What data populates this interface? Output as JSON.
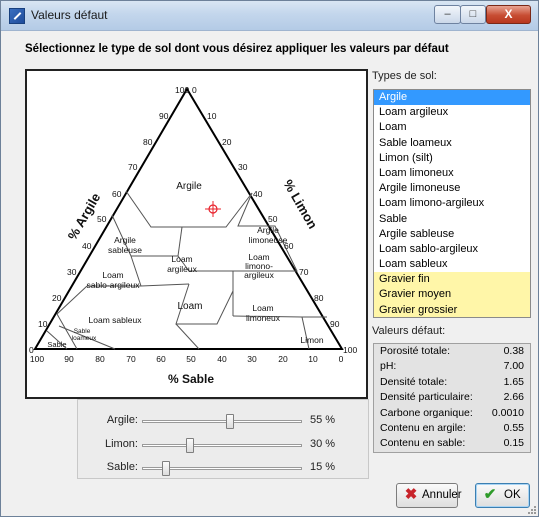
{
  "window": {
    "title": "Valeurs défaut"
  },
  "title_buttons": {
    "minimize": "–",
    "maximize": "□",
    "close": "X"
  },
  "instruction": "Sélectionnez le type de sol dont vous désirez appliquer les valeurs par défaut",
  "triangle": {
    "axis_argile": "% Argile",
    "axis_limon": "% Limon",
    "axis_sable": "% Sable",
    "left_ticks": [
      "100",
      "90",
      "80",
      "70",
      "60",
      "50",
      "40",
      "30",
      "20",
      "10",
      "0"
    ],
    "right_ticks": [
      "0",
      "10",
      "20",
      "30",
      "40",
      "50",
      "60",
      "70",
      "80",
      "90",
      "100"
    ],
    "bottom_ticks": [
      "100",
      "90",
      "80",
      "70",
      "60",
      "50",
      "40",
      "30",
      "20",
      "10",
      "0"
    ],
    "regions": {
      "argile": "Argile",
      "argile_limoneuse": [
        "Argile",
        "limoneuse"
      ],
      "argile_sableuse": [
        "Argile",
        "sableuse"
      ],
      "loam_argileux": [
        "Loam",
        "argileux"
      ],
      "loam_limono_argileux": [
        "Loam",
        "limono-",
        "argileux"
      ],
      "loam_sablo_argileux": [
        "Loam",
        "sablo-argileux"
      ],
      "loam": "Loam",
      "loam_sableux": "Loam sableux",
      "loam_limoneux": [
        "Loam",
        "limoneux"
      ],
      "limon": "Limon",
      "sable_loameux": [
        "Sable",
        "loameux"
      ],
      "sable": "Sable"
    },
    "marker": {
      "argile": 55,
      "limon": 30,
      "sable": 15
    }
  },
  "soil_types": {
    "label": "Types de sol:",
    "items": [
      {
        "label": "Argile",
        "selected": true,
        "gravel": false
      },
      {
        "label": "Loam argileux",
        "selected": false,
        "gravel": false
      },
      {
        "label": "Loam",
        "selected": false,
        "gravel": false
      },
      {
        "label": "Sable loameux",
        "selected": false,
        "gravel": false
      },
      {
        "label": "Limon (silt)",
        "selected": false,
        "gravel": false
      },
      {
        "label": "Loam limoneux",
        "selected": false,
        "gravel": false
      },
      {
        "label": "Argile limoneuse",
        "selected": false,
        "gravel": false
      },
      {
        "label": "Loam limono-argileux",
        "selected": false,
        "gravel": false
      },
      {
        "label": "Sable",
        "selected": false,
        "gravel": false
      },
      {
        "label": "Argile sableuse",
        "selected": false,
        "gravel": false
      },
      {
        "label": "Loam sablo-argileux",
        "selected": false,
        "gravel": false
      },
      {
        "label": "Loam sableux",
        "selected": false,
        "gravel": false
      },
      {
        "label": "Gravier fin",
        "selected": false,
        "gravel": true
      },
      {
        "label": "Gravier moyen",
        "selected": false,
        "gravel": true
      },
      {
        "label": "Gravier grossier",
        "selected": false,
        "gravel": true
      }
    ]
  },
  "default_values": {
    "label": "Valeurs défaut:",
    "rows": [
      {
        "name": "Porosité totale:",
        "value": "0.38"
      },
      {
        "name": "pH:",
        "value": "7.00"
      },
      {
        "name": "Densité totale:",
        "value": "1.65"
      },
      {
        "name": "Densité particulaire:",
        "value": "2.66"
      },
      {
        "name": "Carbone organique:",
        "value": "0.0010"
      },
      {
        "name": "Contenu en argile:",
        "value": "0.55"
      },
      {
        "name": "Contenu en sable:",
        "value": "0.15"
      }
    ]
  },
  "sliders": [
    {
      "label": "Argile:",
      "value": 55,
      "display": "55 %"
    },
    {
      "label": "Limon:",
      "value": 30,
      "display": "30 %"
    },
    {
      "label": "Sable:",
      "value": 15,
      "display": "15 %"
    }
  ],
  "buttons": {
    "cancel": "Annuler",
    "ok": "OK"
  },
  "colors": {
    "selection": "#3399ff",
    "gravel_highlight": "#fff6a8",
    "marker": "#e8202a",
    "cancel_icon": "#c8232a",
    "ok_icon": "#2f9b2a"
  }
}
